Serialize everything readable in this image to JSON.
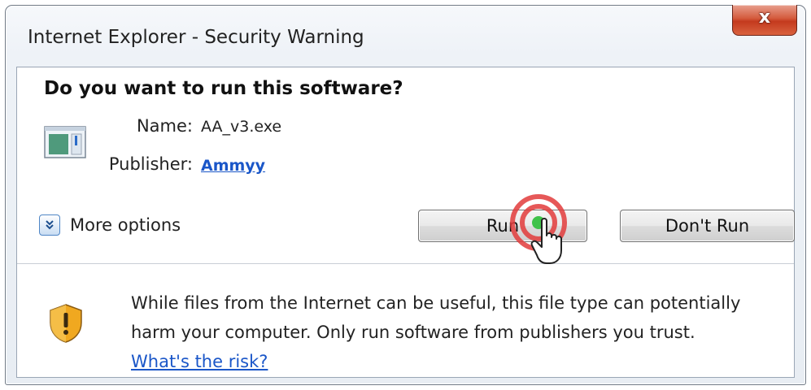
{
  "window": {
    "title": "Internet Explorer - Security Warning",
    "close_glyph": "x"
  },
  "prompt": {
    "heading": "Do you want to run this software?"
  },
  "details": {
    "name_label": "Name:",
    "name_value": "AA_v3.exe",
    "publisher_label": "Publisher:",
    "publisher_value": "Ammyy"
  },
  "more_options": {
    "label": "More options",
    "icon": "chevron-double-down-icon"
  },
  "buttons": {
    "run": "Run",
    "dont_run": "Don't Run"
  },
  "warning": {
    "text": "While files from the Internet can be useful, this file type can potentially harm your computer. Only run software from publishers you trust.",
    "link": "What's the risk?",
    "icon": "shield-warning-icon"
  },
  "colors": {
    "link": "#1a56c8",
    "close_button": "#c43a1e",
    "click_indicator": "#e23b3b",
    "shield": "#f0a820"
  }
}
